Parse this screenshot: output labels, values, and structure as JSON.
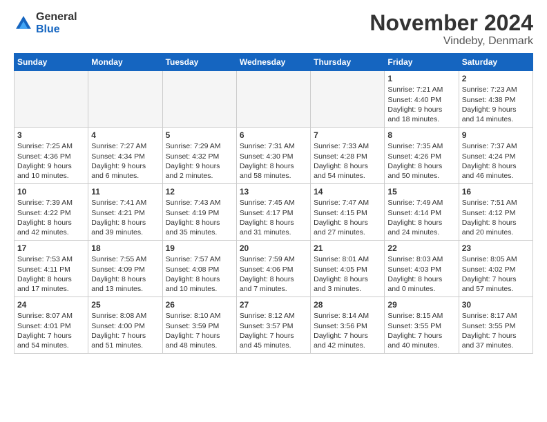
{
  "header": {
    "logo_general": "General",
    "logo_blue": "Blue",
    "title": "November 2024",
    "subtitle": "Vindeby, Denmark"
  },
  "days_of_week": [
    "Sunday",
    "Monday",
    "Tuesday",
    "Wednesday",
    "Thursday",
    "Friday",
    "Saturday"
  ],
  "weeks": [
    [
      {
        "day": "",
        "empty": true
      },
      {
        "day": "",
        "empty": true
      },
      {
        "day": "",
        "empty": true
      },
      {
        "day": "",
        "empty": true
      },
      {
        "day": "",
        "empty": true
      },
      {
        "day": "1",
        "lines": [
          "Sunrise: 7:21 AM",
          "Sunset: 4:40 PM",
          "Daylight: 9 hours",
          "and 18 minutes."
        ]
      },
      {
        "day": "2",
        "lines": [
          "Sunrise: 7:23 AM",
          "Sunset: 4:38 PM",
          "Daylight: 9 hours",
          "and 14 minutes."
        ]
      }
    ],
    [
      {
        "day": "3",
        "lines": [
          "Sunrise: 7:25 AM",
          "Sunset: 4:36 PM",
          "Daylight: 9 hours",
          "and 10 minutes."
        ]
      },
      {
        "day": "4",
        "lines": [
          "Sunrise: 7:27 AM",
          "Sunset: 4:34 PM",
          "Daylight: 9 hours",
          "and 6 minutes."
        ]
      },
      {
        "day": "5",
        "lines": [
          "Sunrise: 7:29 AM",
          "Sunset: 4:32 PM",
          "Daylight: 9 hours",
          "and 2 minutes."
        ]
      },
      {
        "day": "6",
        "lines": [
          "Sunrise: 7:31 AM",
          "Sunset: 4:30 PM",
          "Daylight: 8 hours",
          "and 58 minutes."
        ]
      },
      {
        "day": "7",
        "lines": [
          "Sunrise: 7:33 AM",
          "Sunset: 4:28 PM",
          "Daylight: 8 hours",
          "and 54 minutes."
        ]
      },
      {
        "day": "8",
        "lines": [
          "Sunrise: 7:35 AM",
          "Sunset: 4:26 PM",
          "Daylight: 8 hours",
          "and 50 minutes."
        ]
      },
      {
        "day": "9",
        "lines": [
          "Sunrise: 7:37 AM",
          "Sunset: 4:24 PM",
          "Daylight: 8 hours",
          "and 46 minutes."
        ]
      }
    ],
    [
      {
        "day": "10",
        "lines": [
          "Sunrise: 7:39 AM",
          "Sunset: 4:22 PM",
          "Daylight: 8 hours",
          "and 42 minutes."
        ]
      },
      {
        "day": "11",
        "lines": [
          "Sunrise: 7:41 AM",
          "Sunset: 4:21 PM",
          "Daylight: 8 hours",
          "and 39 minutes."
        ]
      },
      {
        "day": "12",
        "lines": [
          "Sunrise: 7:43 AM",
          "Sunset: 4:19 PM",
          "Daylight: 8 hours",
          "and 35 minutes."
        ]
      },
      {
        "day": "13",
        "lines": [
          "Sunrise: 7:45 AM",
          "Sunset: 4:17 PM",
          "Daylight: 8 hours",
          "and 31 minutes."
        ]
      },
      {
        "day": "14",
        "lines": [
          "Sunrise: 7:47 AM",
          "Sunset: 4:15 PM",
          "Daylight: 8 hours",
          "and 27 minutes."
        ]
      },
      {
        "day": "15",
        "lines": [
          "Sunrise: 7:49 AM",
          "Sunset: 4:14 PM",
          "Daylight: 8 hours",
          "and 24 minutes."
        ]
      },
      {
        "day": "16",
        "lines": [
          "Sunrise: 7:51 AM",
          "Sunset: 4:12 PM",
          "Daylight: 8 hours",
          "and 20 minutes."
        ]
      }
    ],
    [
      {
        "day": "17",
        "lines": [
          "Sunrise: 7:53 AM",
          "Sunset: 4:11 PM",
          "Daylight: 8 hours",
          "and 17 minutes."
        ]
      },
      {
        "day": "18",
        "lines": [
          "Sunrise: 7:55 AM",
          "Sunset: 4:09 PM",
          "Daylight: 8 hours",
          "and 13 minutes."
        ]
      },
      {
        "day": "19",
        "lines": [
          "Sunrise: 7:57 AM",
          "Sunset: 4:08 PM",
          "Daylight: 8 hours",
          "and 10 minutes."
        ]
      },
      {
        "day": "20",
        "lines": [
          "Sunrise: 7:59 AM",
          "Sunset: 4:06 PM",
          "Daylight: 8 hours",
          "and 7 minutes."
        ]
      },
      {
        "day": "21",
        "lines": [
          "Sunrise: 8:01 AM",
          "Sunset: 4:05 PM",
          "Daylight: 8 hours",
          "and 3 minutes."
        ]
      },
      {
        "day": "22",
        "lines": [
          "Sunrise: 8:03 AM",
          "Sunset: 4:03 PM",
          "Daylight: 8 hours",
          "and 0 minutes."
        ]
      },
      {
        "day": "23",
        "lines": [
          "Sunrise: 8:05 AM",
          "Sunset: 4:02 PM",
          "Daylight: 7 hours",
          "and 57 minutes."
        ]
      }
    ],
    [
      {
        "day": "24",
        "lines": [
          "Sunrise: 8:07 AM",
          "Sunset: 4:01 PM",
          "Daylight: 7 hours",
          "and 54 minutes."
        ]
      },
      {
        "day": "25",
        "lines": [
          "Sunrise: 8:08 AM",
          "Sunset: 4:00 PM",
          "Daylight: 7 hours",
          "and 51 minutes."
        ]
      },
      {
        "day": "26",
        "lines": [
          "Sunrise: 8:10 AM",
          "Sunset: 3:59 PM",
          "Daylight: 7 hours",
          "and 48 minutes."
        ]
      },
      {
        "day": "27",
        "lines": [
          "Sunrise: 8:12 AM",
          "Sunset: 3:57 PM",
          "Daylight: 7 hours",
          "and 45 minutes."
        ]
      },
      {
        "day": "28",
        "lines": [
          "Sunrise: 8:14 AM",
          "Sunset: 3:56 PM",
          "Daylight: 7 hours",
          "and 42 minutes."
        ]
      },
      {
        "day": "29",
        "lines": [
          "Sunrise: 8:15 AM",
          "Sunset: 3:55 PM",
          "Daylight: 7 hours",
          "and 40 minutes."
        ]
      },
      {
        "day": "30",
        "lines": [
          "Sunrise: 8:17 AM",
          "Sunset: 3:55 PM",
          "Daylight: 7 hours",
          "and 37 minutes."
        ]
      }
    ]
  ]
}
